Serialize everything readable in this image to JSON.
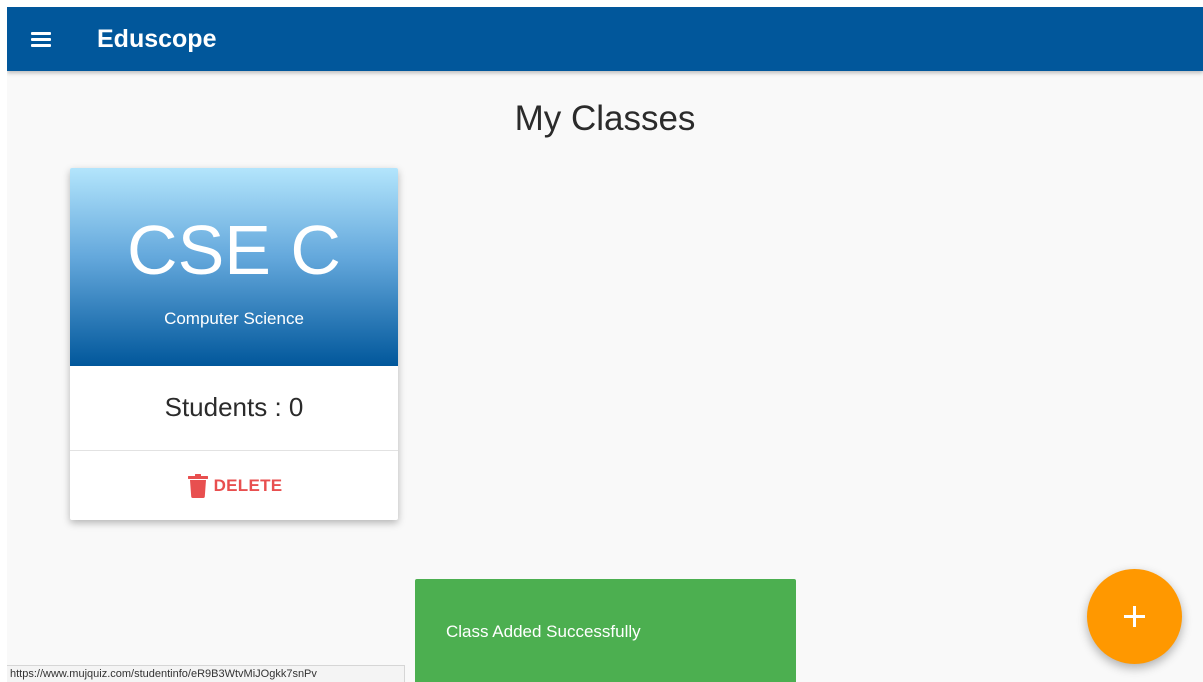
{
  "app": {
    "title": "Eduscope",
    "menu_icon": "hamburger-menu-icon"
  },
  "page": {
    "title": "My Classes"
  },
  "classes": [
    {
      "name": "CSE C",
      "subject": "Computer Science",
      "students_text": "Students : 0",
      "delete_label": "DELETE",
      "delete_icon": "trash-icon"
    }
  ],
  "snackbar": {
    "message": "Class Added Successfully"
  },
  "fab": {
    "icon": "plus-icon"
  },
  "status_bar": {
    "url": "https://www.mujquiz.com/studentinfo/eR9B3WtvMiJOgkk7snPv"
  },
  "colors": {
    "appbar": "#01579b",
    "delete": "#e84f4f",
    "snackbar": "#4caf50",
    "fab": "#ff9800"
  }
}
